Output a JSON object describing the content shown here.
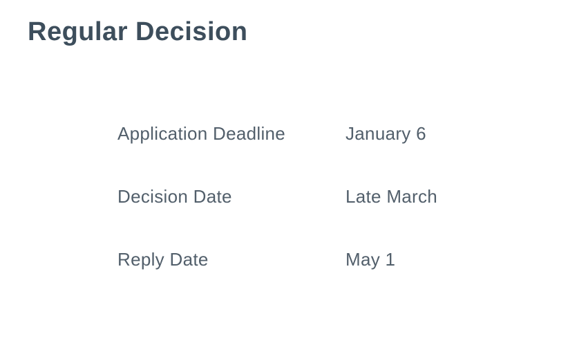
{
  "heading": "Regular Decision",
  "rows": [
    {
      "label": "Application Deadline",
      "value": "January 6"
    },
    {
      "label": "Decision Date",
      "value": "Late March"
    },
    {
      "label": "Reply Date",
      "value": "May 1"
    }
  ]
}
